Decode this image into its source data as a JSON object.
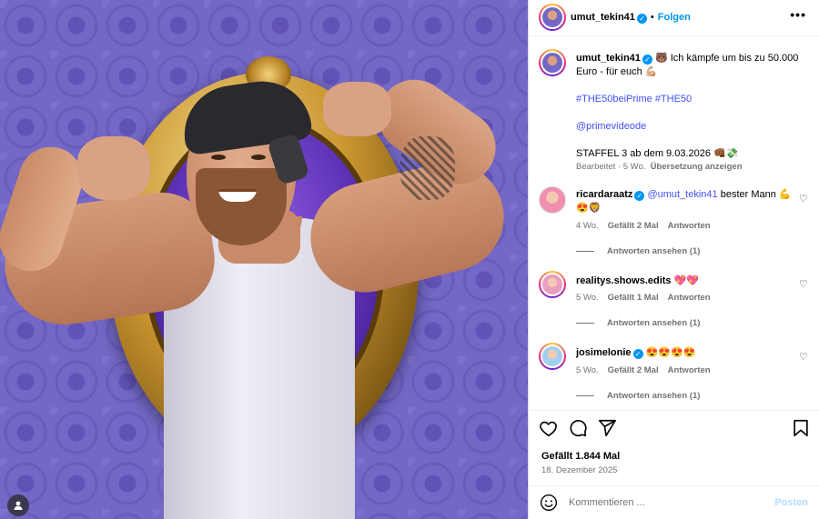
{
  "post": {
    "username": "umut_tekin41",
    "follow_label": "Folgen",
    "more_label": "•••",
    "caption_main": "🐻 Ich kämpfe um bis zu 50.000 Euro - für euch 💪🏼",
    "caption_hashtags": "#THE50beiPrime #THE50",
    "caption_mention": "@primevideode",
    "caption_season": "STAFFEL 3 ab dem 9.03.2026 👊🏾💸",
    "caption_edited": "Bearbeitet · 5 Wo.",
    "caption_translate": "Übersetzung anzeigen"
  },
  "comments": [
    {
      "username": "ricardaraatz",
      "mention": "@umut_tekin41",
      "text": " bester Mann 💪😍🦁",
      "time": "4 Wo.",
      "likes": "Gefällt 2 Mal",
      "reply": "Antworten",
      "view_replies": "Antworten ansehen (1)"
    },
    {
      "username": "realitys.shows.edits",
      "mention": "",
      "text": "💖💖",
      "time": "5 Wo.",
      "likes": "Gefällt 1 Mal",
      "reply": "Antworten",
      "view_replies": "Antworten ansehen (1)"
    },
    {
      "username": "josimelonie",
      "mention": "",
      "text": "😍😍😍😍",
      "time": "5 Wo.",
      "likes": "Gefällt 2 Mal",
      "reply": "Antworten",
      "view_replies": "Antworten ansehen (1)"
    }
  ],
  "footer": {
    "likes": "Gefällt 1.844 Mal",
    "date": "18. Dezember 2025",
    "comment_placeholder": "Kommentieren ...",
    "post_label": "Posten"
  },
  "icons": {
    "like": "heart-icon",
    "comment": "comment-icon",
    "share": "share-icon",
    "save": "bookmark-icon",
    "emoji": "emoji-icon",
    "tagged": "user-tag-icon"
  },
  "colors": {
    "accent": "#0095f6",
    "link": "#4150f7",
    "muted": "#737373",
    "background_purple": "#7468c6"
  }
}
